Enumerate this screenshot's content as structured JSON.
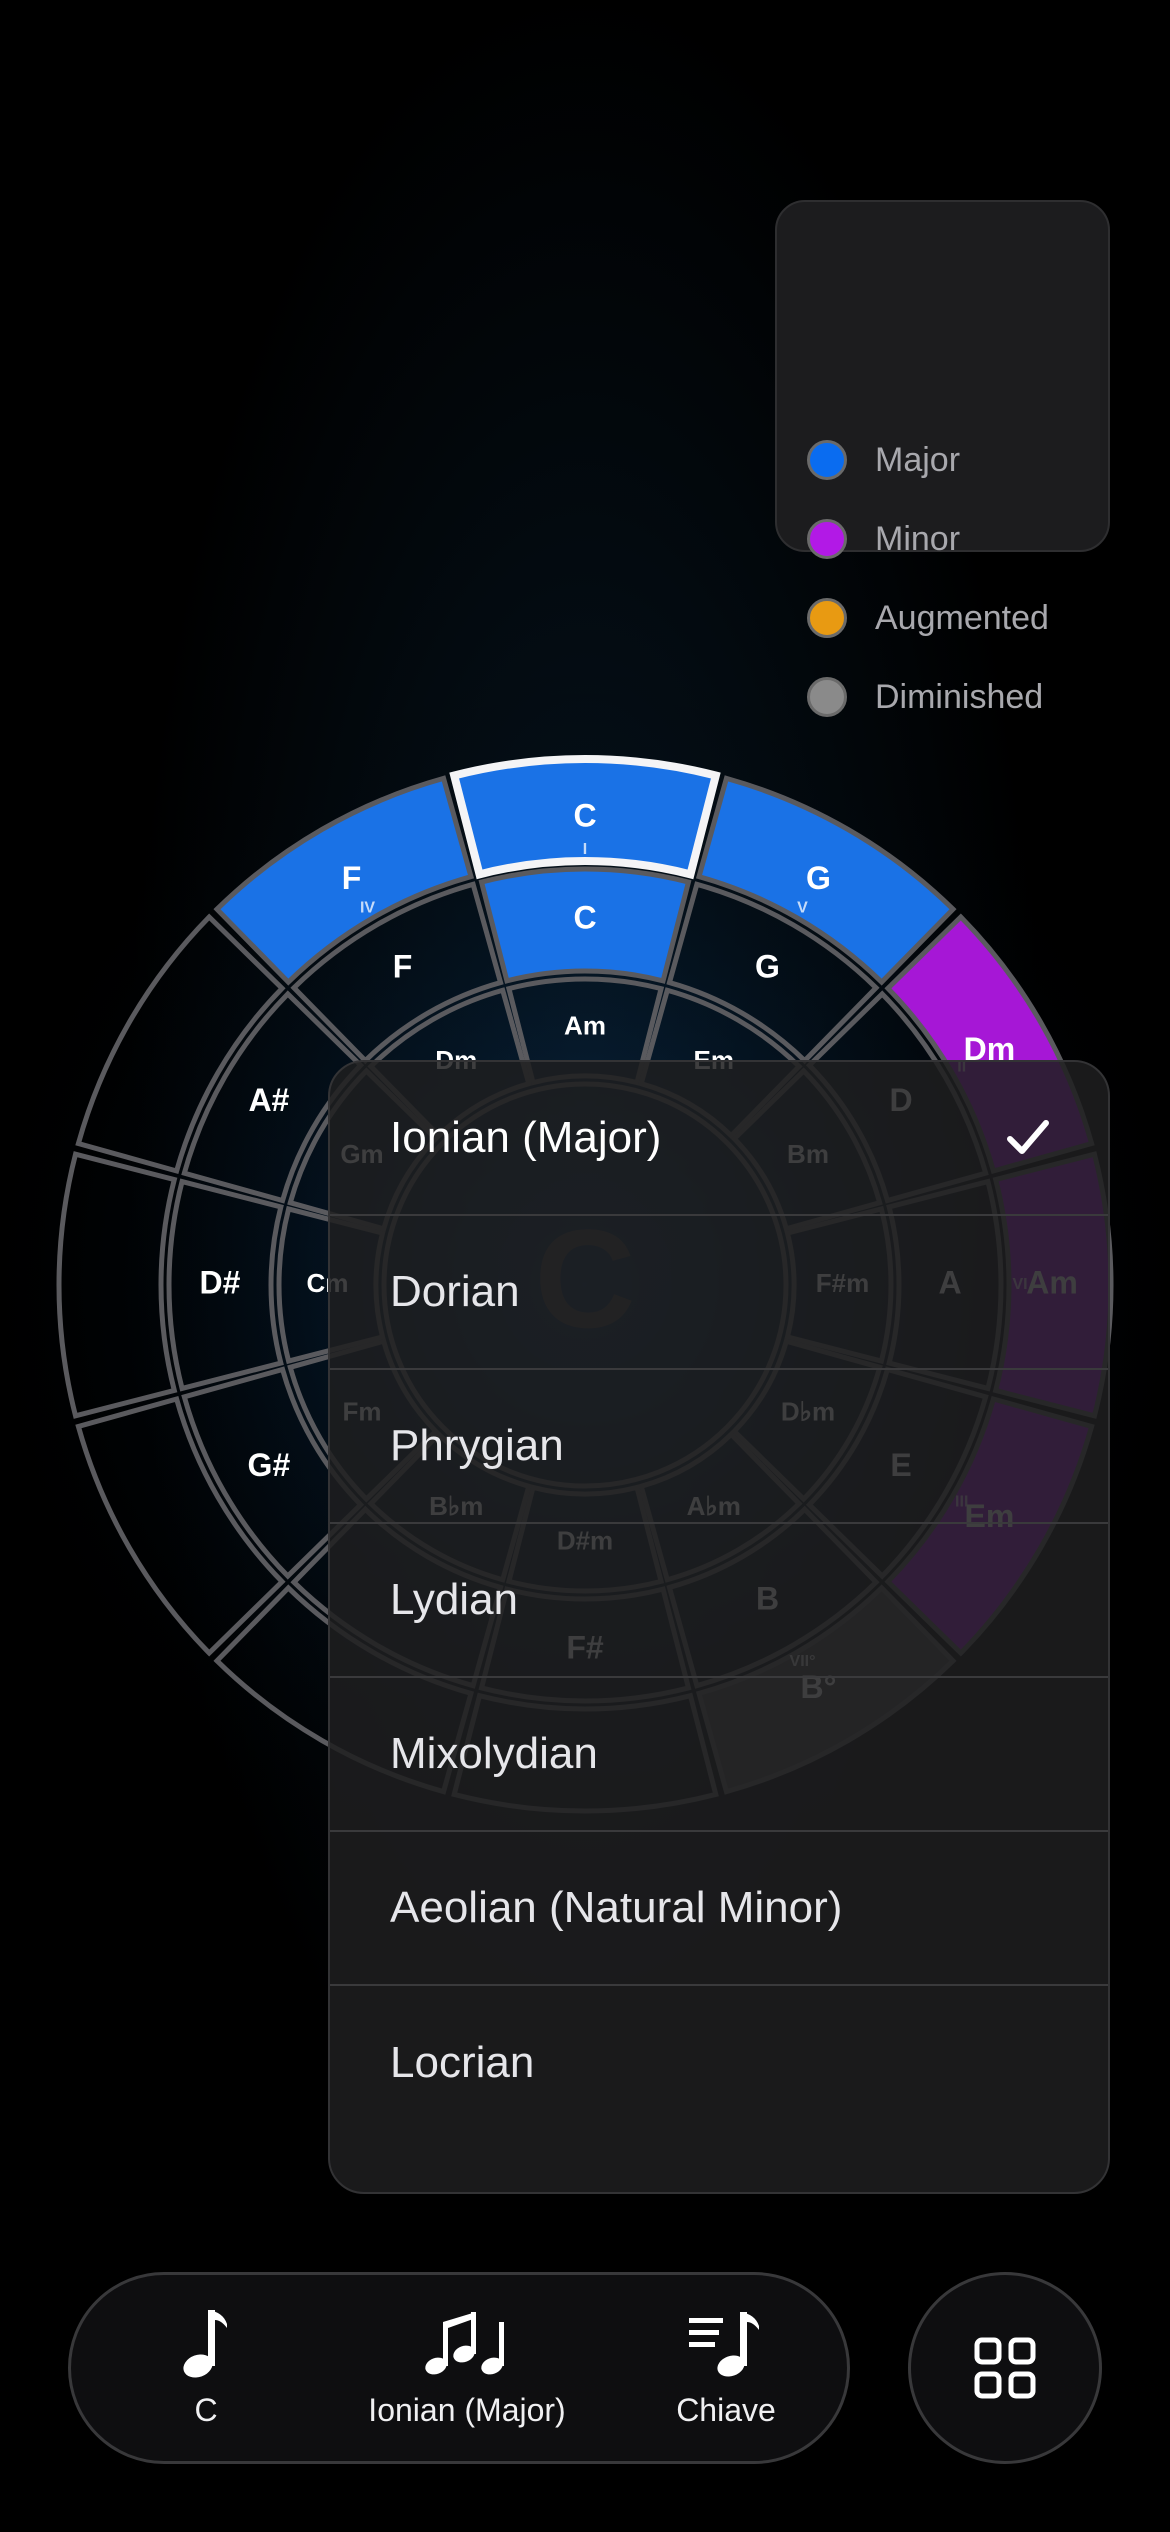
{
  "legend": {
    "items": [
      {
        "label": "Major",
        "color": "#0a6cf0"
      },
      {
        "label": "Minor",
        "color": "#b219e6"
      },
      {
        "label": "Augmented",
        "color": "#e89a12"
      },
      {
        "label": "Diminished",
        "color": "#8a8a8a"
      }
    ]
  },
  "wheel": {
    "center_label": "C",
    "outer_ring": [
      {
        "chord": "C",
        "numeral": "I",
        "type": "major",
        "selected": true
      },
      {
        "chord": "G",
        "numeral": "V",
        "type": "major"
      },
      {
        "chord": "Dm",
        "numeral": "II",
        "type": "minor"
      },
      {
        "chord": "Am",
        "numeral": "VI",
        "type": "minor"
      },
      {
        "chord": "Em",
        "numeral": "III",
        "type": "minor"
      },
      {
        "chord": "B°",
        "numeral": "VII°",
        "type": "diminished"
      },
      {
        "chord": "",
        "numeral": "",
        "type": "none"
      },
      {
        "chord": "",
        "numeral": "",
        "type": "none"
      },
      {
        "chord": "",
        "numeral": "",
        "type": "none"
      },
      {
        "chord": "",
        "numeral": "",
        "type": "none"
      },
      {
        "chord": "",
        "numeral": "",
        "type": "none"
      },
      {
        "chord": "F",
        "numeral": "IV",
        "type": "major"
      }
    ],
    "middle_ring": [
      {
        "chord": "C",
        "highlighted": true
      },
      {
        "chord": "G"
      },
      {
        "chord": "D"
      },
      {
        "chord": "A"
      },
      {
        "chord": "E"
      },
      {
        "chord": "B"
      },
      {
        "chord": "F#"
      },
      {
        "chord": ""
      },
      {
        "chord": "G#"
      },
      {
        "chord": "D#"
      },
      {
        "chord": "A#"
      },
      {
        "chord": "F"
      }
    ],
    "inner_ring": [
      {
        "chord": "Am"
      },
      {
        "chord": "Em"
      },
      {
        "chord": "Bm"
      },
      {
        "chord": "F#m"
      },
      {
        "chord": "D♭m"
      },
      {
        "chord": "A♭m"
      },
      {
        "chord": "D#m"
      },
      {
        "chord": "B♭m"
      },
      {
        "chord": "Fm"
      },
      {
        "chord": "Cm"
      },
      {
        "chord": "Gm"
      },
      {
        "chord": "Dm"
      }
    ]
  },
  "mode_menu": {
    "items": [
      {
        "label": "Ionian (Major)",
        "selected": true
      },
      {
        "label": "Dorian"
      },
      {
        "label": "Phrygian"
      },
      {
        "label": "Lydian"
      },
      {
        "label": "Mixolydian"
      },
      {
        "label": "Aeolian (Natural Minor)"
      },
      {
        "label": "Locrian"
      }
    ],
    "check_icon": "checkmark-icon"
  },
  "tabbar": {
    "tabs": [
      {
        "label": "C",
        "icon": "eighth-note-icon"
      },
      {
        "label": "Ionian (Major)",
        "icon": "notes-icon"
      },
      {
        "label": "Chiave",
        "icon": "key-signature-icon"
      }
    ],
    "grid_icon": "grid-icon"
  }
}
